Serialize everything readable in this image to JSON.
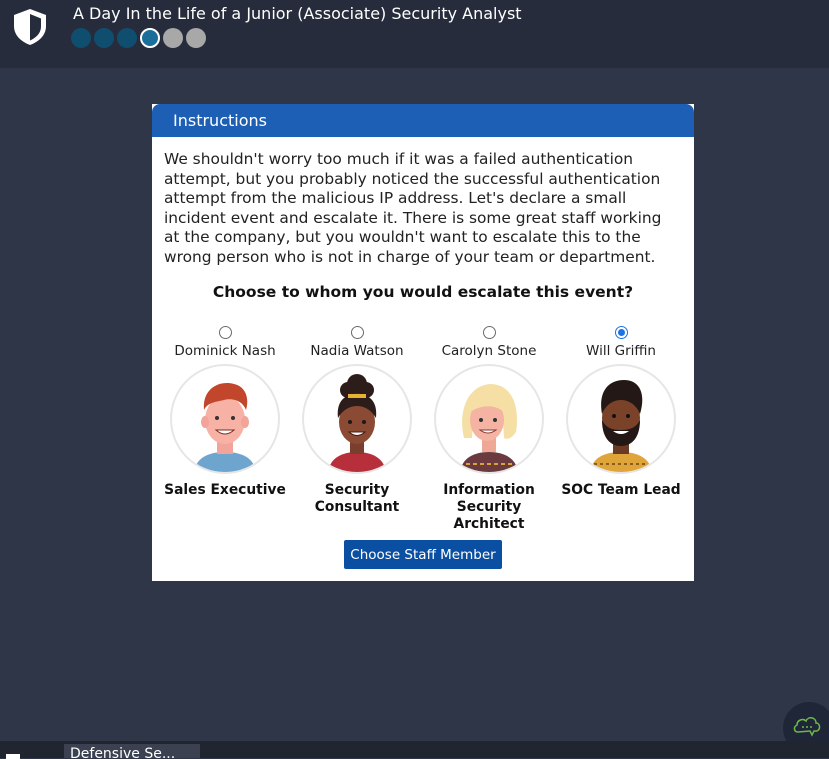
{
  "app": {
    "title": "A Day In the Life of a Junior (Associate) Security Analyst",
    "icon": "shield-icon",
    "progress": {
      "completed": 3,
      "current": 4,
      "total": 6
    }
  },
  "dialog": {
    "header": "Instructions",
    "body": "We shouldn't worry too much if it was a failed authentication attempt, but you probably noticed the successful authentication attempt from the malicious IP address. Let's declare a small incident event and escalate it. There is some great staff working at the company, but you wouldn't want to escalate this to the wrong person who is not in charge of your team or department.",
    "question": "Choose to whom you would escalate this event?",
    "staff": [
      {
        "name": "Dominick Nash",
        "role": "Sales Executive",
        "selected": false
      },
      {
        "name": "Nadia Watson",
        "role": "Security Consultant",
        "selected": false
      },
      {
        "name": "Carolyn Stone",
        "role": "Information Security Architect",
        "selected": false
      },
      {
        "name": "Will Griffin",
        "role": "SOC Team Lead",
        "selected": true
      }
    ],
    "button_label": "Choose Staff Member"
  },
  "taskbar": {
    "tab_label": "Defensive Se..."
  },
  "colors": {
    "background": "#2f3647",
    "topbar": "#262c3b",
    "header": "#1e5fb6",
    "button": "#0b4fa3",
    "progress_done": "#0f4e6e",
    "progress_todo": "#a8a8a8",
    "radio_selected": "#1a73e8"
  }
}
